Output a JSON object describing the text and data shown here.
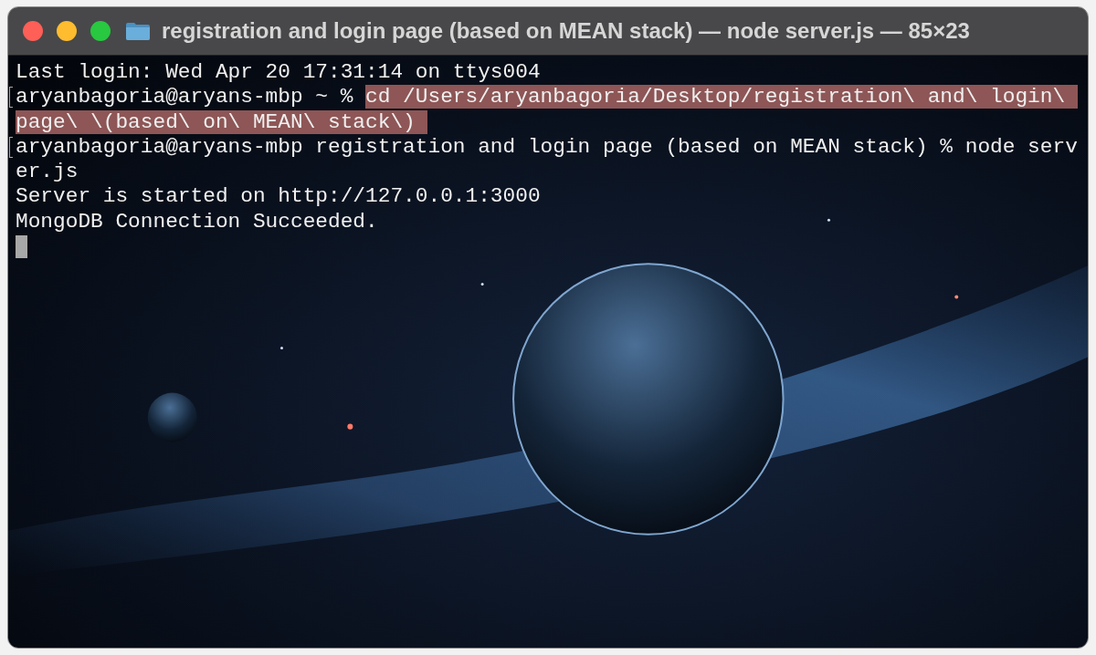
{
  "window": {
    "title": "registration and login page (based on MEAN stack) — node server.js — 85×23"
  },
  "terminal": {
    "lines": [
      {
        "marked": false,
        "segments": [
          {
            "text": "Last login: Wed Apr 20 17:31:14 on ttys004",
            "selected": false
          }
        ]
      },
      {
        "marked": true,
        "segments": [
          {
            "text": "aryanbagoria@aryans-mbp ~ % ",
            "selected": false
          },
          {
            "text": "cd /Users/aryanbagoria/Desktop/registration\\ and\\ login\\",
            "selected": true
          }
        ]
      },
      {
        "marked": false,
        "segments": [
          {
            "text": "page\\ \\(based\\ on\\ MEAN\\ stack\\)",
            "selected": true
          }
        ]
      },
      {
        "marked": true,
        "segments": [
          {
            "text": "aryanbagoria@aryans-mbp registration and login page (based on MEAN stack) % node serv",
            "selected": false
          }
        ]
      },
      {
        "marked": false,
        "segments": [
          {
            "text": "er.js",
            "selected": false
          }
        ]
      },
      {
        "marked": false,
        "segments": [
          {
            "text": "Server is started on http://127.0.0.1:3000",
            "selected": false
          }
        ]
      },
      {
        "marked": false,
        "segments": [
          {
            "text": "MongoDB Connection Succeeded.",
            "selected": false
          }
        ]
      }
    ]
  }
}
